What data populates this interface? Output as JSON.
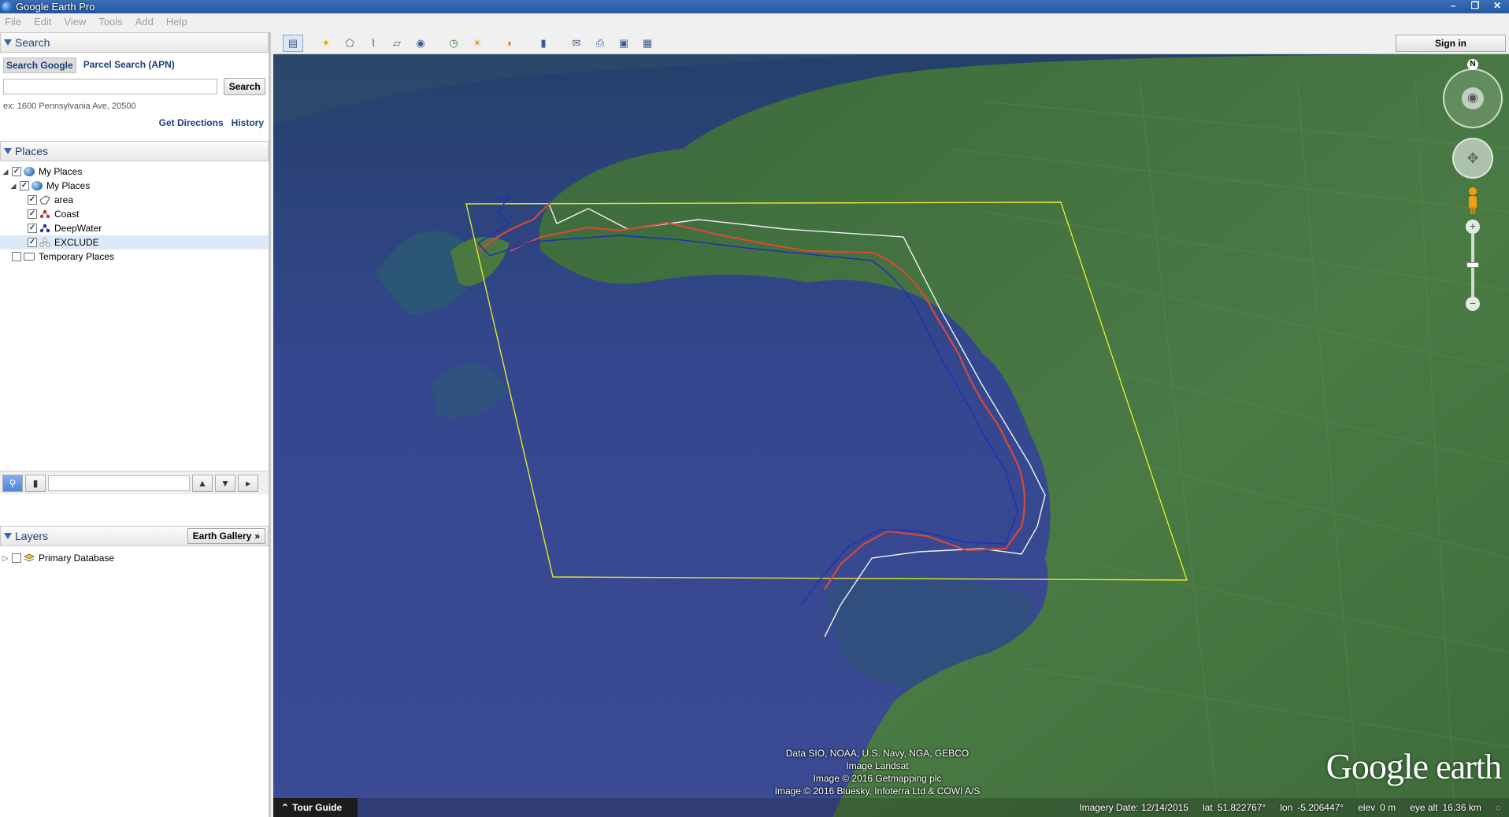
{
  "window": {
    "title": "Google Earth Pro",
    "controls": {
      "minimize": "–",
      "restore": "❐",
      "close": "✕"
    }
  },
  "menu": [
    "File",
    "Edit",
    "View",
    "Tools",
    "Add",
    "Help"
  ],
  "search": {
    "header": "Search",
    "tabs": [
      "Search Google",
      "Parcel Search (APN)"
    ],
    "input_value": "",
    "button": "Search",
    "hint": "ex: 1600 Pennsylvania Ave, 20500",
    "links": [
      "Get Directions",
      "History"
    ]
  },
  "places": {
    "header": "Places",
    "items": [
      {
        "label": "My Places",
        "checked": true,
        "icon": "globe-icon",
        "expander": "◢"
      },
      {
        "label": "My Places",
        "checked": true,
        "icon": "globe-icon",
        "expander": "◢"
      },
      {
        "label": "area",
        "checked": true,
        "icon": "polygon-icon"
      },
      {
        "label": "Coast",
        "checked": true,
        "icon": "red-path-icon"
      },
      {
        "label": "DeepWater",
        "checked": true,
        "icon": "blue-path-icon"
      },
      {
        "label": "EXCLUDE",
        "checked": true,
        "icon": "white-path-icon",
        "selected": true
      },
      {
        "label": "Temporary Places",
        "checked": false,
        "icon": "folder-icon"
      }
    ]
  },
  "layers": {
    "header": "Layers",
    "gallery_button": "Earth Gallery",
    "items": [
      {
        "label": "Primary Database",
        "checked": false,
        "icon": "layers-icon",
        "expander": "▷"
      }
    ]
  },
  "toolbar": {
    "signin": "Sign in",
    "icons": [
      "sidebar-toggle-icon",
      "placemark-icon",
      "polygon-add-icon",
      "path-add-icon",
      "overlay-icon",
      "tour-record-icon",
      "historical-imagery-icon",
      "sunlight-icon",
      "planets-icon",
      "ruler-icon",
      "email-icon",
      "print-icon",
      "save-image-icon",
      "maps-icon"
    ]
  },
  "map": {
    "attribution": [
      "Data SIO, NOAA, U.S. Navy, NGA, GEBCO",
      "Image Landsat",
      "Image © 2016 Getmapping plc",
      "Image © 2016 Bluesky, Infoterra Ltd & COWI A/S"
    ],
    "logo_main": "Google",
    "logo_sub": " earth",
    "tour_guide": "Tour Guide",
    "status": {
      "imagery_date": "Imagery Date: 12/14/2015",
      "lat_label": "lat",
      "lat": "51.822767°",
      "lon_label": "lon",
      "lon": "-5.206447°",
      "elev_label": "elev",
      "elev": "0 m",
      "eye_alt_label": "eye alt",
      "eye_alt": "16.36 km"
    },
    "nav_north": "N",
    "colors": {
      "coast": "#d4493a",
      "deepwater": "#1d2fb8",
      "exclude": "#f2f2f2",
      "area": "#e5e62e"
    }
  }
}
